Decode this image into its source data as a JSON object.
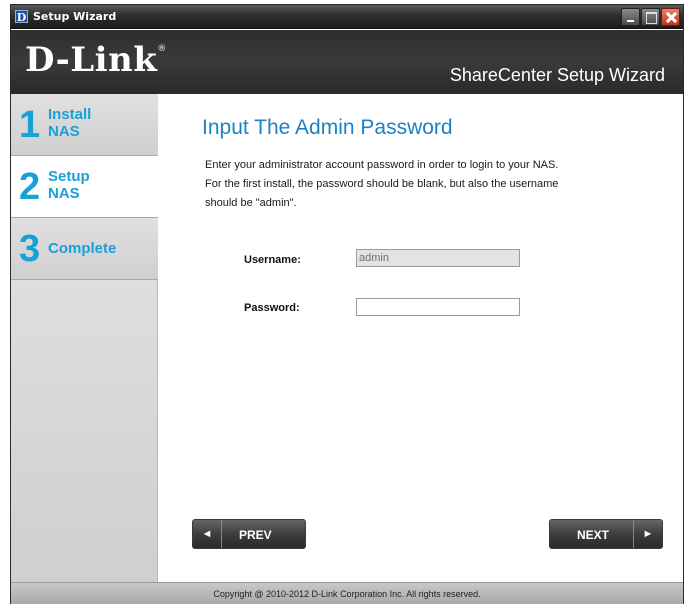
{
  "window": {
    "title": "Setup Wizard",
    "icon_letter": "D"
  },
  "banner": {
    "logo": "D-Link",
    "logo_mark": "®",
    "product": "ShareCenter Setup Wizard"
  },
  "steps": [
    {
      "num": "1",
      "label_line1": "Install",
      "label_line2": "NAS",
      "active": false
    },
    {
      "num": "2",
      "label_line1": "Setup",
      "label_line2": "NAS",
      "active": true
    },
    {
      "num": "3",
      "label_line1": "Complete",
      "label_line2": "",
      "active": false
    }
  ],
  "main": {
    "heading": "Input The Admin Password",
    "description_lines": [
      "Enter your administrator account password in order to login to your NAS.",
      "For the first install, the password should be blank, but also the username",
      "should be \"admin\"."
    ],
    "username_label": "Username:",
    "username_value": "admin",
    "password_label": "Password:",
    "password_value": ""
  },
  "buttons": {
    "prev_label": "PREV",
    "next_label": "NEXT",
    "prev_icon": "◄",
    "next_icon": "►"
  },
  "footer": {
    "copyright": "Copyright @ 2010-2012 D-Link Corporation Inc. All rights reserved."
  },
  "colors": {
    "accent": "#1aa0d8",
    "heading": "#1d82c2",
    "banner": "#333333"
  }
}
